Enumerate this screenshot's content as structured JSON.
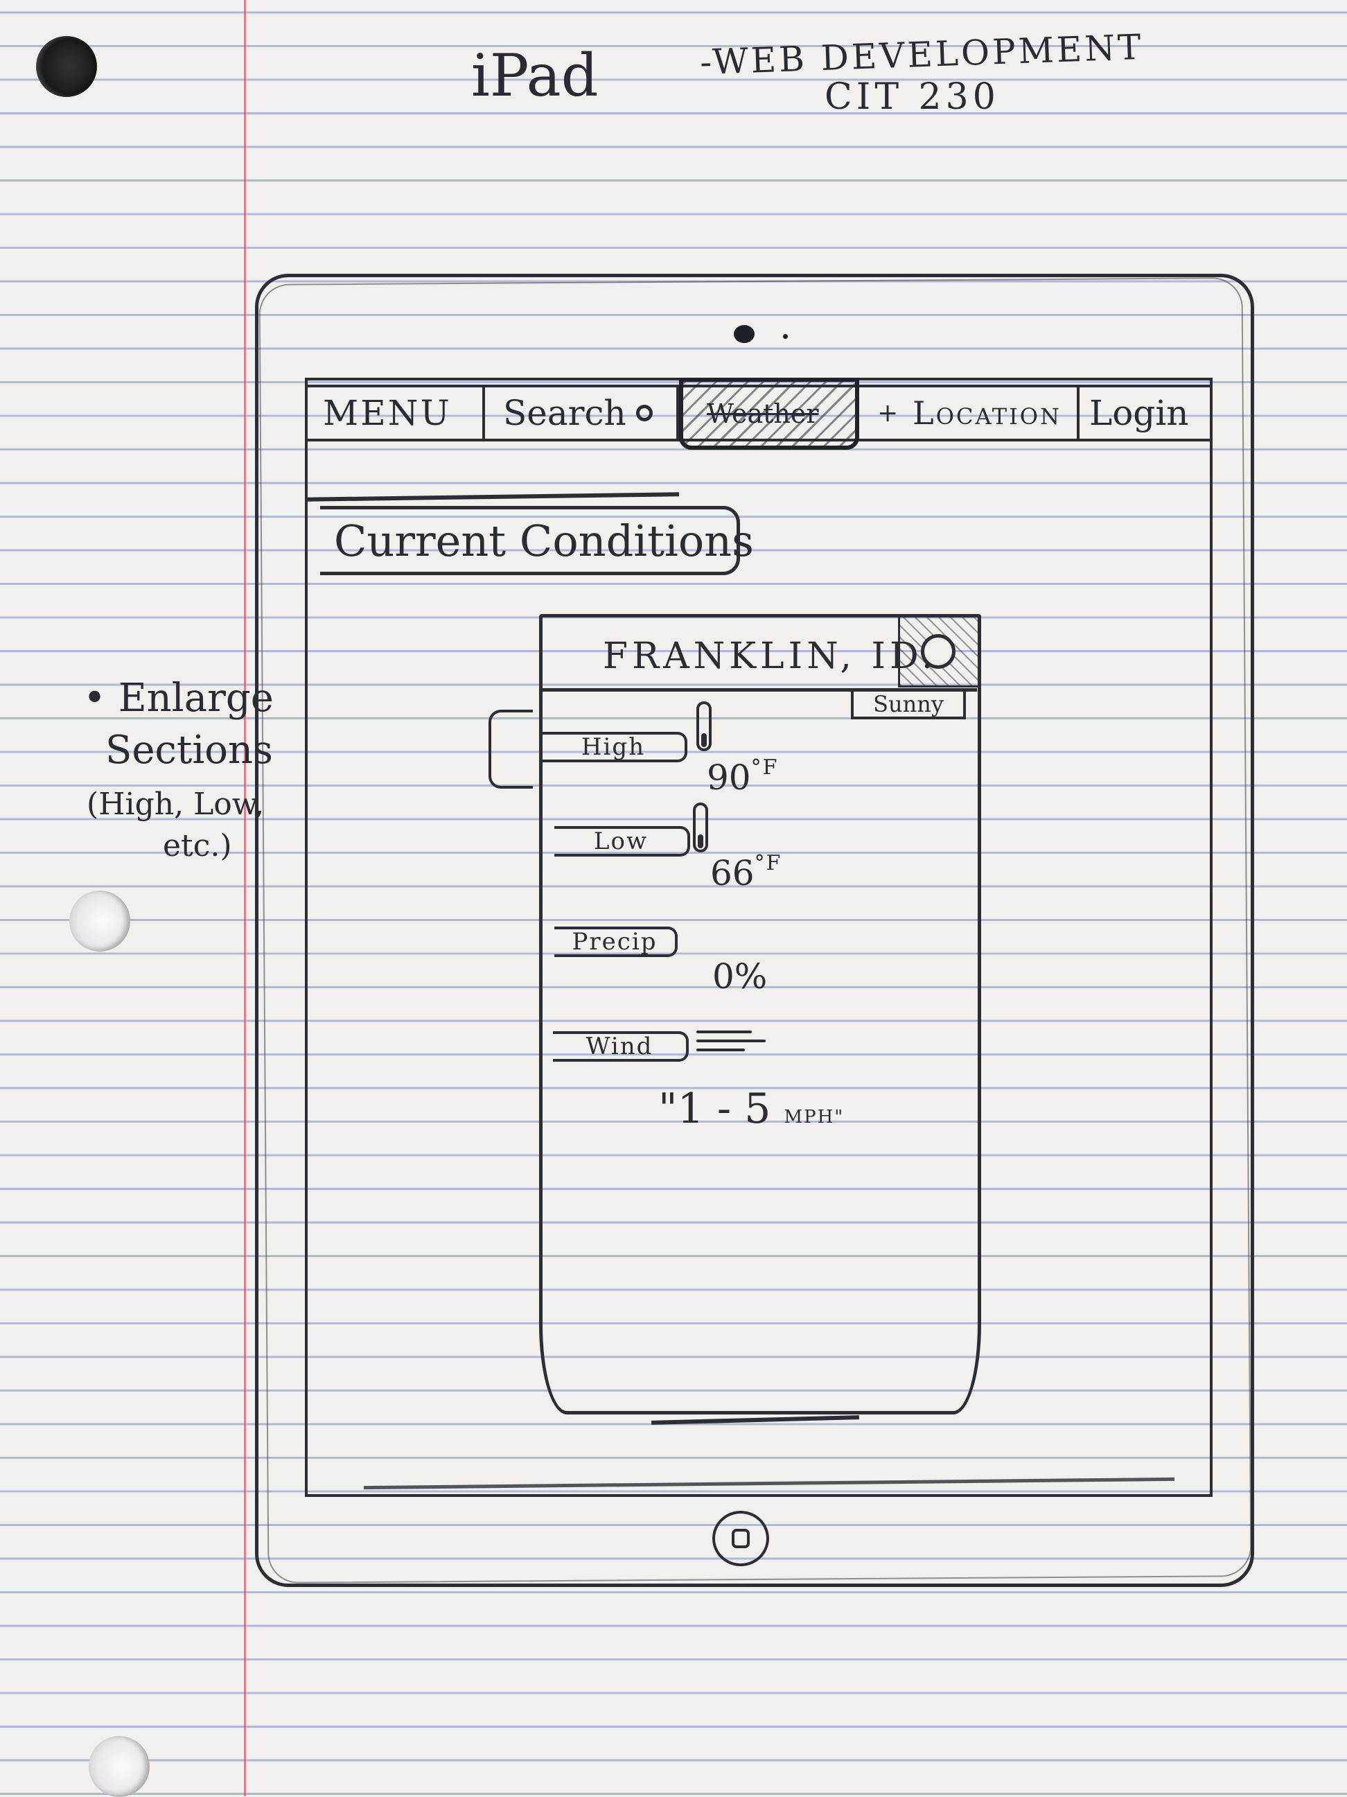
{
  "page": {
    "title": "iPad",
    "course_line1": "-WEB DEVELOPMENT",
    "course_line2": "CIT 230"
  },
  "side_note": {
    "bullet": "•",
    "line1": "Enlarge",
    "line2": "Sections",
    "line3": "(High, Low,",
    "line4": "etc.)"
  },
  "navbar": {
    "items": [
      {
        "label": "MENU"
      },
      {
        "label": "Search",
        "icon": "search-icon"
      },
      {
        "label": "Weather",
        "state": "active"
      },
      {
        "label": "Location",
        "prefix": "+"
      },
      {
        "label": "Login"
      }
    ]
  },
  "section": {
    "heading": "Current Conditions"
  },
  "weather_card": {
    "location": "FRANKLIN, ID.",
    "condition": "Sunny",
    "condition_icon": "sun-icon",
    "stats": [
      {
        "label": "High",
        "value": "90",
        "unit": "°F",
        "icon": "thermometer-icon"
      },
      {
        "label": "Low",
        "value": "66",
        "unit": "°F",
        "icon": "thermometer-icon"
      },
      {
        "label": "Precip",
        "value": "0%"
      },
      {
        "label": "Wind",
        "value": "\"1 - 5",
        "unit": "MPH\"",
        "icon": "wind-icon"
      }
    ]
  }
}
